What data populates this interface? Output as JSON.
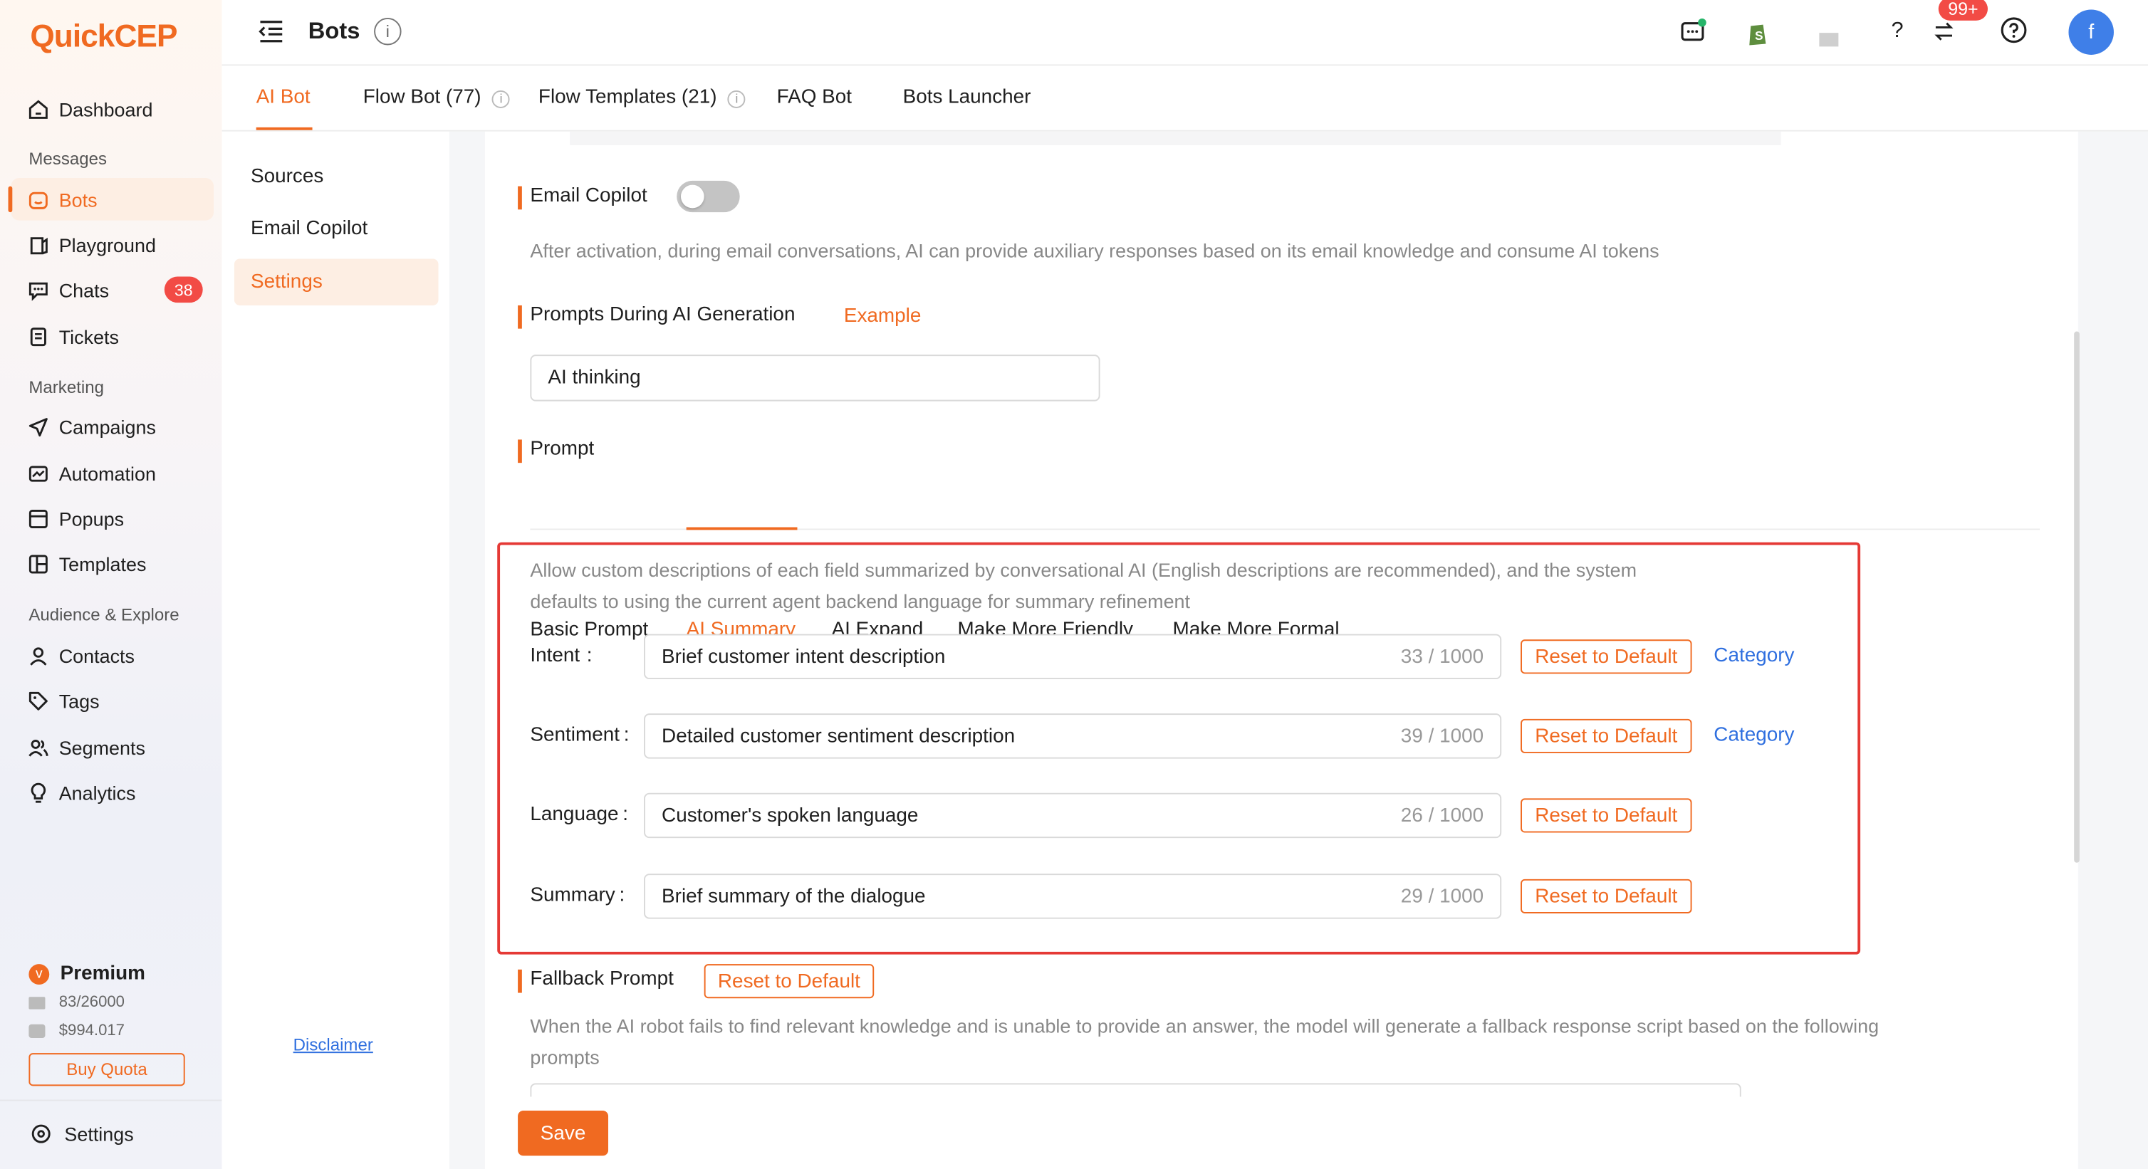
{
  "brand": {
    "logo_text": "QuickCEP",
    "accent": "#f06a21"
  },
  "sidebar": {
    "items": [
      {
        "label": "Dashboard",
        "icon": "home-icon"
      },
      {
        "label": "Bots",
        "icon": "bot-icon"
      },
      {
        "label": "Playground",
        "icon": "playground-icon"
      },
      {
        "label": "Chats",
        "icon": "chat-icon",
        "badge": "38"
      },
      {
        "label": "Tickets",
        "icon": "ticket-icon"
      },
      {
        "label": "Campaigns",
        "icon": "send-icon"
      },
      {
        "label": "Automation",
        "icon": "automation-icon"
      },
      {
        "label": "Popups",
        "icon": "popup-icon"
      },
      {
        "label": "Templates",
        "icon": "template-icon"
      },
      {
        "label": "Contacts",
        "icon": "user-icon"
      },
      {
        "label": "Tags",
        "icon": "tag-icon"
      },
      {
        "label": "Segments",
        "icon": "users-icon"
      },
      {
        "label": "Analytics",
        "icon": "bulb-icon"
      }
    ],
    "sections": {
      "messages": "Messages",
      "marketing": "Marketing",
      "audience": "Audience & Explore"
    },
    "plan": {
      "name": "Premium",
      "quota": "83/26000",
      "balance": "$994.017",
      "buy_label": "Buy Quota"
    },
    "settings_label": "Settings"
  },
  "header": {
    "title": "Bots",
    "notification_badge": "99+",
    "avatar_initial": "f"
  },
  "tabs": [
    {
      "label": "AI Bot",
      "active": true
    },
    {
      "label": "Flow Bot (77)"
    },
    {
      "label": "Flow Templates (21)"
    },
    {
      "label": "FAQ Bot"
    },
    {
      "label": "Bots Launcher"
    }
  ],
  "subnav": {
    "items": [
      "Sources",
      "Email Copilot",
      "Settings"
    ],
    "active": "Settings",
    "disclaimer": "Disclaimer"
  },
  "email_copilot": {
    "title": "Email Copilot",
    "enabled": false,
    "description": "After activation, during email conversations, AI can provide auxiliary responses based on its email knowledge and consume AI tokens"
  },
  "prompts_generation": {
    "title": "Prompts During AI Generation",
    "example_label": "Example",
    "value": "AI thinking"
  },
  "prompt": {
    "title": "Prompt",
    "tabs": [
      "Basic Prompt",
      "AI Summary",
      "AI Expand",
      "Make More Friendly",
      "Make More Formal"
    ],
    "active_tab": "AI Summary",
    "description_line1": "Allow custom descriptions of each field summarized by conversational AI (English descriptions are recommended), and the system",
    "description_line2": "defaults to using the current agent backend language for summary refinement",
    "fields": [
      {
        "label": "Intent",
        "value": "Brief customer intent description",
        "count": "33 / 1000",
        "reset": "Reset to Default",
        "link": "Category"
      },
      {
        "label": "Sentiment",
        "value": "Detailed customer sentiment description",
        "count": "39 / 1000",
        "reset": "Reset to Default",
        "link": "Category"
      },
      {
        "label": "Language",
        "value": "Customer's spoken language",
        "count": "26 / 1000",
        "reset": "Reset to Default"
      },
      {
        "label": "Summary",
        "value": "Brief summary of the dialogue",
        "count": "29 / 1000",
        "reset": "Reset to Default"
      }
    ]
  },
  "fallback": {
    "title": "Fallback Prompt",
    "reset": "Reset to Default",
    "description_line1": "When the AI robot fails to find relevant knowledge and is unable to provide an answer, the model will generate a fallback response script based on the following",
    "description_line2": "prompts"
  },
  "save_label": "Save",
  "highlight_color": "#e53935"
}
